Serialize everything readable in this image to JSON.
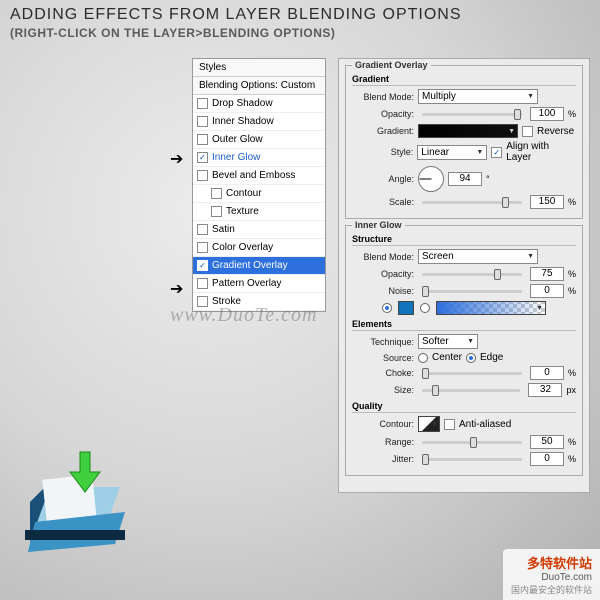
{
  "header": {
    "title": "ADDING EFFECTS FROM LAYER BLENDING OPTIONS",
    "subtitle": "(RIGHT-CLICK ON THE LAYER>BLENDING OPTIONS)"
  },
  "styles_panel": {
    "header": "Styles",
    "sub": "Blending Options: Custom",
    "items": [
      {
        "label": "Drop Shadow",
        "checked": false,
        "indent": false
      },
      {
        "label": "Inner Shadow",
        "checked": false,
        "indent": false
      },
      {
        "label": "Outer Glow",
        "checked": false,
        "indent": false
      },
      {
        "label": "Inner Glow",
        "checked": true,
        "indent": false,
        "active_text": true
      },
      {
        "label": "Bevel and Emboss",
        "checked": false,
        "indent": false
      },
      {
        "label": "Contour",
        "checked": false,
        "indent": true
      },
      {
        "label": "Texture",
        "checked": false,
        "indent": true
      },
      {
        "label": "Satin",
        "checked": false,
        "indent": false
      },
      {
        "label": "Color Overlay",
        "checked": false,
        "indent": false
      },
      {
        "label": "Gradient Overlay",
        "checked": true,
        "indent": false,
        "selected": true
      },
      {
        "label": "Pattern Overlay",
        "checked": false,
        "indent": false
      },
      {
        "label": "Stroke",
        "checked": false,
        "indent": false
      }
    ]
  },
  "gradient_overlay": {
    "legend": "Gradient Overlay",
    "section": "Gradient",
    "blend_mode_label": "Blend Mode:",
    "blend_mode": "Multiply",
    "opacity_label": "Opacity:",
    "opacity": "100",
    "opacity_unit": "%",
    "gradient_label": "Gradient:",
    "reverse_label": "Reverse",
    "reverse": false,
    "style_label": "Style:",
    "style": "Linear",
    "align_label": "Align with Layer",
    "align": true,
    "angle_label": "Angle:",
    "angle": "94",
    "angle_unit": "°",
    "scale_label": "Scale:",
    "scale": "150",
    "scale_unit": "%"
  },
  "inner_glow": {
    "legend": "Inner Glow",
    "structure_label": "Structure",
    "blend_mode_label": "Blend Mode:",
    "blend_mode": "Screen",
    "opacity_label": "Opacity:",
    "opacity": "75",
    "opacity_unit": "%",
    "noise_label": "Noise:",
    "noise": "0",
    "noise_unit": "%",
    "elements_label": "Elements",
    "technique_label": "Technique:",
    "technique": "Softer",
    "source_label": "Source:",
    "source_center": "Center",
    "source_edge": "Edge",
    "choke_label": "Choke:",
    "choke": "0",
    "choke_unit": "%",
    "size_label": "Size:",
    "size": "32",
    "size_unit": "px",
    "quality_label": "Quality",
    "contour_label": "Contour:",
    "anti_label": "Anti-aliased",
    "range_label": "Range:",
    "range": "50",
    "range_unit": "%",
    "jitter_label": "Jitter:",
    "jitter": "0",
    "jitter_unit": "%"
  },
  "watermark": "www.DuoTe.com",
  "footer": {
    "brand": "多特软件站",
    "domain": "DuoTe.com",
    "tagline": "国内最安全的软件站"
  }
}
